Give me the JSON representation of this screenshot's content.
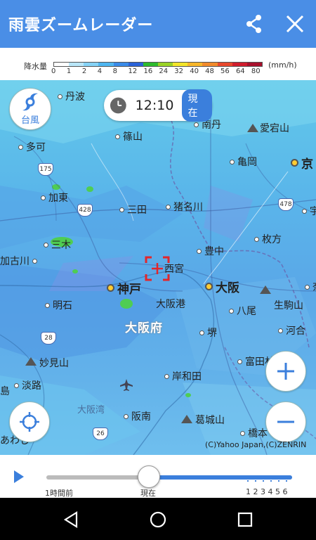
{
  "header": {
    "title": "雨雲ズームレーダー"
  },
  "legend": {
    "title": "降水量",
    "unit": "(mm/h)",
    "ticks": [
      "0",
      "1",
      "2",
      "4",
      "8",
      "12",
      "16",
      "24",
      "32",
      "40",
      "48",
      "56",
      "64",
      "80"
    ],
    "colors": [
      "#ffffff",
      "#b9e6f8",
      "#86d3f6",
      "#4fb6f0",
      "#3a8be8",
      "#2a62d8",
      "#2dbb2d",
      "#9ad326",
      "#f3e52a",
      "#f7b62a",
      "#f18a2b",
      "#e8482c",
      "#d01d2d",
      "#a8102c"
    ]
  },
  "time": {
    "value": "12:10",
    "badge": "現在"
  },
  "buttons": {
    "typhoon": "台風"
  },
  "map": {
    "places": [
      {
        "name": "丹波"
      },
      {
        "name": "篠山"
      },
      {
        "name": "南丹"
      },
      {
        "name": "愛宕山"
      },
      {
        "name": "多可"
      },
      {
        "name": "亀岡"
      },
      {
        "name": "京"
      },
      {
        "name": "加東"
      },
      {
        "name": "三田"
      },
      {
        "name": "猪名川"
      },
      {
        "name": "宇"
      },
      {
        "name": "三木"
      },
      {
        "name": "枚方"
      },
      {
        "name": "加古川"
      },
      {
        "name": "豊中"
      },
      {
        "name": "西宮"
      },
      {
        "name": "神戸"
      },
      {
        "name": "大阪"
      },
      {
        "name": "明石"
      },
      {
        "name": "大阪港"
      },
      {
        "name": "八尾"
      },
      {
        "name": "生駒山"
      },
      {
        "name": "堺"
      },
      {
        "name": "河合"
      },
      {
        "name": "妙見山"
      },
      {
        "name": "富田林"
      },
      {
        "name": "淡路"
      },
      {
        "name": "岸和田"
      },
      {
        "name": "阪南"
      },
      {
        "name": "葛城山"
      },
      {
        "name": "橋本"
      },
      {
        "name": "あわじ"
      },
      {
        "name": "島"
      },
      {
        "name": "奈"
      }
    ],
    "prefecture": "大阪府",
    "sea": "大阪湾",
    "routes": [
      "175",
      "428",
      "478",
      "28",
      "26"
    ],
    "copyright": "(C)Yahoo Japan,(C)ZENRIN"
  },
  "timeline": {
    "start_label": "1時間前",
    "now_label": "現在",
    "future_labels": "1 2 3 4 5 6"
  }
}
